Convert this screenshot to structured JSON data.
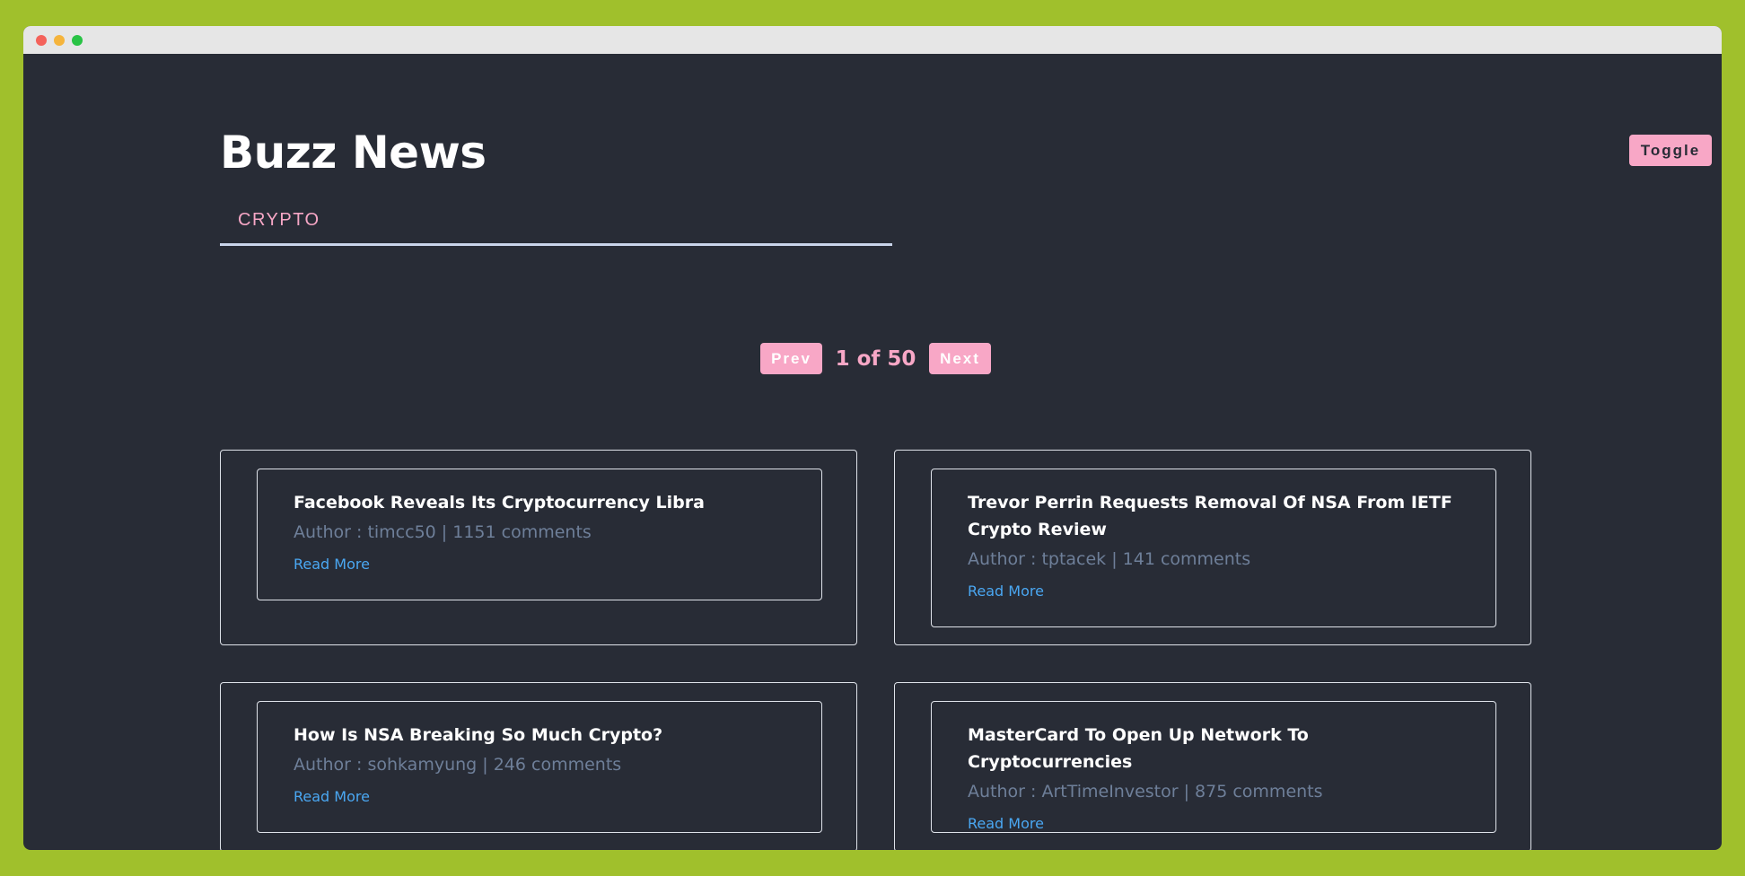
{
  "app": {
    "title": "Buzz News",
    "toggle_label": "Toggle"
  },
  "tabs": [
    {
      "label": "CRYPTO"
    }
  ],
  "pagination": {
    "prev_label": "Prev",
    "current_page": "1",
    "separator": "of",
    "total_pages": "50",
    "indicator": "1 of 50",
    "next_label": "Next"
  },
  "articles": [
    {
      "title": "Facebook Reveals Its Cryptocurrency Libra",
      "author_prefix": "Author : ",
      "author": "timcc50",
      "divider": " | ",
      "comments": "1151 comments",
      "meta": "Author : timcc50 | 1151 comments",
      "read_more": "Read More"
    },
    {
      "title": "Trevor Perrin Requests Removal Of NSA From IETF Crypto Review",
      "author_prefix": "Author : ",
      "author": "tptacek",
      "divider": " | ",
      "comments": "141 comments",
      "meta": "Author : tptacek | 141 comments",
      "read_more": "Read More"
    },
    {
      "title": "How Is NSA Breaking So Much Crypto?",
      "author_prefix": "Author : ",
      "author": "sohkamyung",
      "divider": " | ",
      "comments": "246 comments",
      "meta": "Author : sohkamyung | 246 comments",
      "read_more": "Read More"
    },
    {
      "title": "MasterCard To Open Up Network To Cryptocurrencies",
      "author_prefix": "Author : ",
      "author": "ArtTimeInvestor",
      "divider": " | ",
      "comments": "875 comments",
      "meta": "Author : ArtTimeInvestor | 875 comments",
      "read_more": "Read More"
    }
  ],
  "colors": {
    "page_background": "#a0c02c",
    "app_background": "#282c36",
    "accent_pink": "#f8a7c6",
    "link_blue": "#4aa7f2",
    "meta_gray": "#6e7f99",
    "card_border": "#dfe3ea"
  }
}
